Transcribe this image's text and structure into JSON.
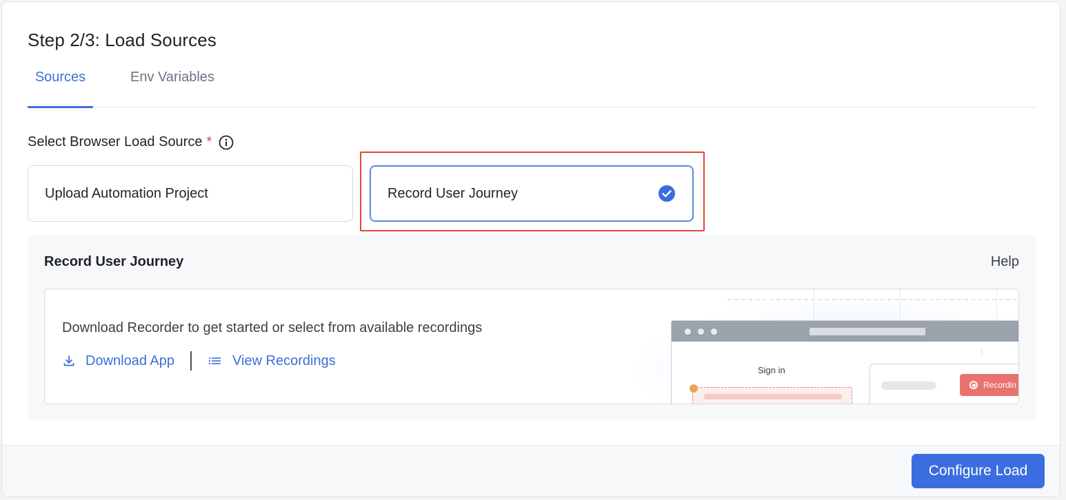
{
  "page": {
    "title": "Step 2/3: Load Sources"
  },
  "tabs": [
    {
      "label": "Sources",
      "active": true
    },
    {
      "label": "Env Variables",
      "active": false
    }
  ],
  "source_select": {
    "label": "Select Browser Load Source",
    "required_mark": "*",
    "info_icon": "info-icon",
    "options": [
      {
        "label": "Upload Automation Project",
        "selected": false
      },
      {
        "label": "Record User Journey",
        "selected": true
      }
    ],
    "check_icon": "check-circle-icon"
  },
  "panel": {
    "title": "Record User Journey",
    "help_label": "Help",
    "description": "Download Recorder to get started or select from available recordings",
    "download_link": "Download App",
    "download_icon": "download-icon",
    "recordings_link": "View Recordings",
    "recordings_icon": "list-icon",
    "preview": {
      "sign_in_label": "Sign in",
      "recording_label": "Recordin"
    }
  },
  "footer": {
    "configure_label": "Configure Load"
  },
  "colors": {
    "accent": "#3b6de0",
    "highlight": "#e0472f",
    "required": "#e5484d"
  }
}
